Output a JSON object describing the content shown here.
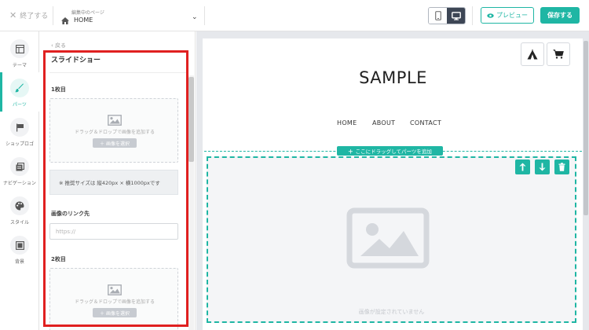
{
  "topbar": {
    "exit_label": "終了する",
    "page_caption": "編集中のページ",
    "page_name": "HOME",
    "preview_label": "プレビュー",
    "save_label": "保存する"
  },
  "rail": {
    "items": [
      {
        "label": "テーマ",
        "icon": "theme-icon"
      },
      {
        "label": "パーツ",
        "icon": "brush-icon",
        "active": true
      },
      {
        "label": "ショップロゴ",
        "icon": "flag-icon"
      },
      {
        "label": "ナビゲーション",
        "icon": "navigation-icon"
      },
      {
        "label": "スタイル",
        "icon": "palette-icon"
      },
      {
        "label": "背景",
        "icon": "background-icon"
      }
    ]
  },
  "panel": {
    "back_label": "戻る",
    "title": "スライドショー",
    "slide1_label": "1枚目",
    "slide2_label": "2枚目",
    "dropzone_text": "ドラッグ＆ドロップで画像を追加する",
    "select_button": "＋ 画像を選択",
    "note": "※ 推奨サイズは 縦420px × 横1000pxです",
    "link_label": "画像のリンク先",
    "link_placeholder": "https://"
  },
  "canvas": {
    "shop_name": "SAMPLE",
    "nav": [
      "HOME",
      "ABOUT",
      "CONTACT"
    ],
    "add_bar": "ここにドラッグしてパーツを追加",
    "no_image_text": "画像が設定されていません"
  },
  "colors": {
    "accent": "#1fb6a4",
    "highlight_box": "#e02020",
    "dark_button": "#3d4655"
  }
}
